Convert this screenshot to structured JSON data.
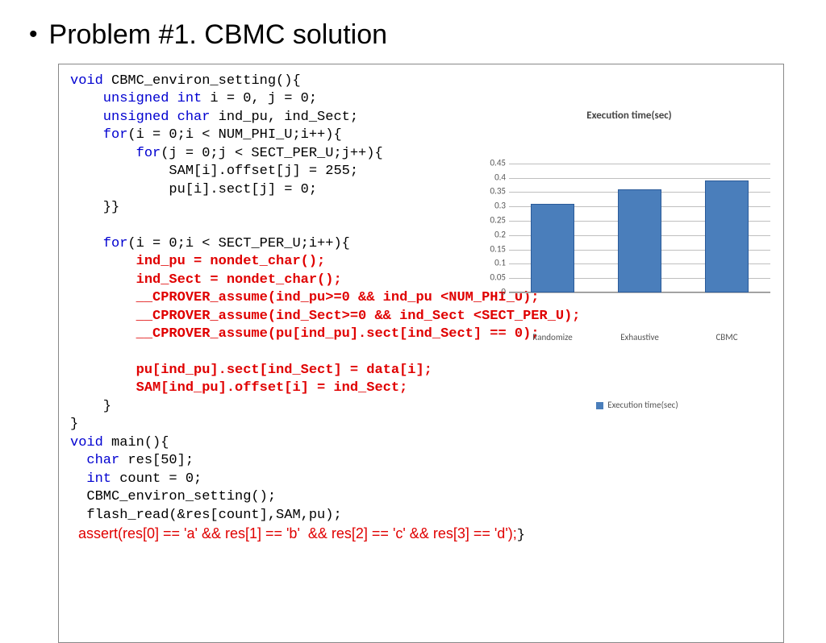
{
  "title": "Problem #1.  CBMC solution",
  "code": {
    "l1": "void",
    "l1b": " CBMC_environ_setting(){",
    "l2": "    unsigned int",
    "l2b": " i = 0, j = 0;",
    "l3": "    unsigned char",
    "l3b": " ind_pu, ind_Sect;",
    "l4": "    for",
    "l4b": "(i = 0;i < NUM_PHI_U;i++){",
    "l5": "        for",
    "l5b": "(j = 0;j < SECT_PER_U;j++){",
    "l6": "            SAM[i].offset[j] = 255;",
    "l7": "            pu[i].sect[j] = 0;",
    "l8": "    }}",
    "l9": "",
    "l10": "    for",
    "l10b": "(i = 0;i < SECT_PER_U;i++){",
    "l11": "        ind_pu = nondet_char();",
    "l12": "        ind_Sect = nondet_char();",
    "l13": "        __CPROVER_assume(ind_pu>=0 && ind_pu <NUM_PHI_U);",
    "l14": "        __CPROVER_assume(ind_Sect>=0 && ind_Sect <SECT_PER_U);",
    "l15": "        __CPROVER_assume(pu[ind_pu].sect[ind_Sect] == 0);",
    "l16": "",
    "l17": "        pu[ind_pu].sect[ind_Sect] = data[i];",
    "l18": "        SAM[ind_pu].offset[i] = ind_Sect;",
    "l19": "    }",
    "l20": "}",
    "l21": "void",
    "l21b": " main(){",
    "l22": "  char",
    "l22b": " res[50];",
    "l23": "  int",
    "l23b": " count = 0;",
    "l24": "  CBMC_environ_setting();",
    "l25": "  flash_read(&res[count],SAM,pu);",
    "assert": "  assert(res[0] == 'a' && res[1] == 'b'  && res[2] == 'c' && res[3] == 'd');",
    "l26b": "}"
  },
  "chart_data": {
    "type": "bar",
    "title": "Execution time(sec)",
    "categories": [
      "Randomize",
      "Exhaustive",
      "CBMC"
    ],
    "values": [
      0.31,
      0.36,
      0.39
    ],
    "ylim": [
      0,
      0.45
    ],
    "ystep": 0.05,
    "legend": "Execution time(sec)",
    "yticks": [
      "0",
      "0.05",
      "0.1",
      "0.15",
      "0.2",
      "0.25",
      "0.3",
      "0.35",
      "0.4",
      "0.45"
    ]
  }
}
